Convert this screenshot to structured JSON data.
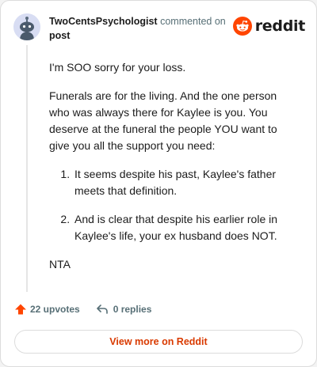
{
  "header": {
    "username": "TwoCentsPsychologist",
    "action_text": "commented on",
    "target_link": "post"
  },
  "brand": {
    "wordmark": "reddit",
    "logo_icon": "reddit-snoo-icon",
    "accent": "#ff4500"
  },
  "comment": {
    "paragraph_1": "I'm SOO sorry for your loss.",
    "paragraph_2": "Funerals are for the living. And the one person who was always there for Kaylee is you. You deserve at the funeral the people YOU want to give you all the support you need:",
    "list_items": [
      "It seems despite his past, Kaylee's father meets that definition.",
      "And is clear that despite his earlier role in Kaylee's life, your ex husband does NOT."
    ],
    "closing": "NTA"
  },
  "actions": {
    "upvotes_label": "22 upvotes",
    "upvote_icon": "upvote-arrow-icon",
    "replies_label": "0 replies",
    "reply_icon": "reply-arrow-icon"
  },
  "footer": {
    "view_more_label": "View more on Reddit"
  }
}
